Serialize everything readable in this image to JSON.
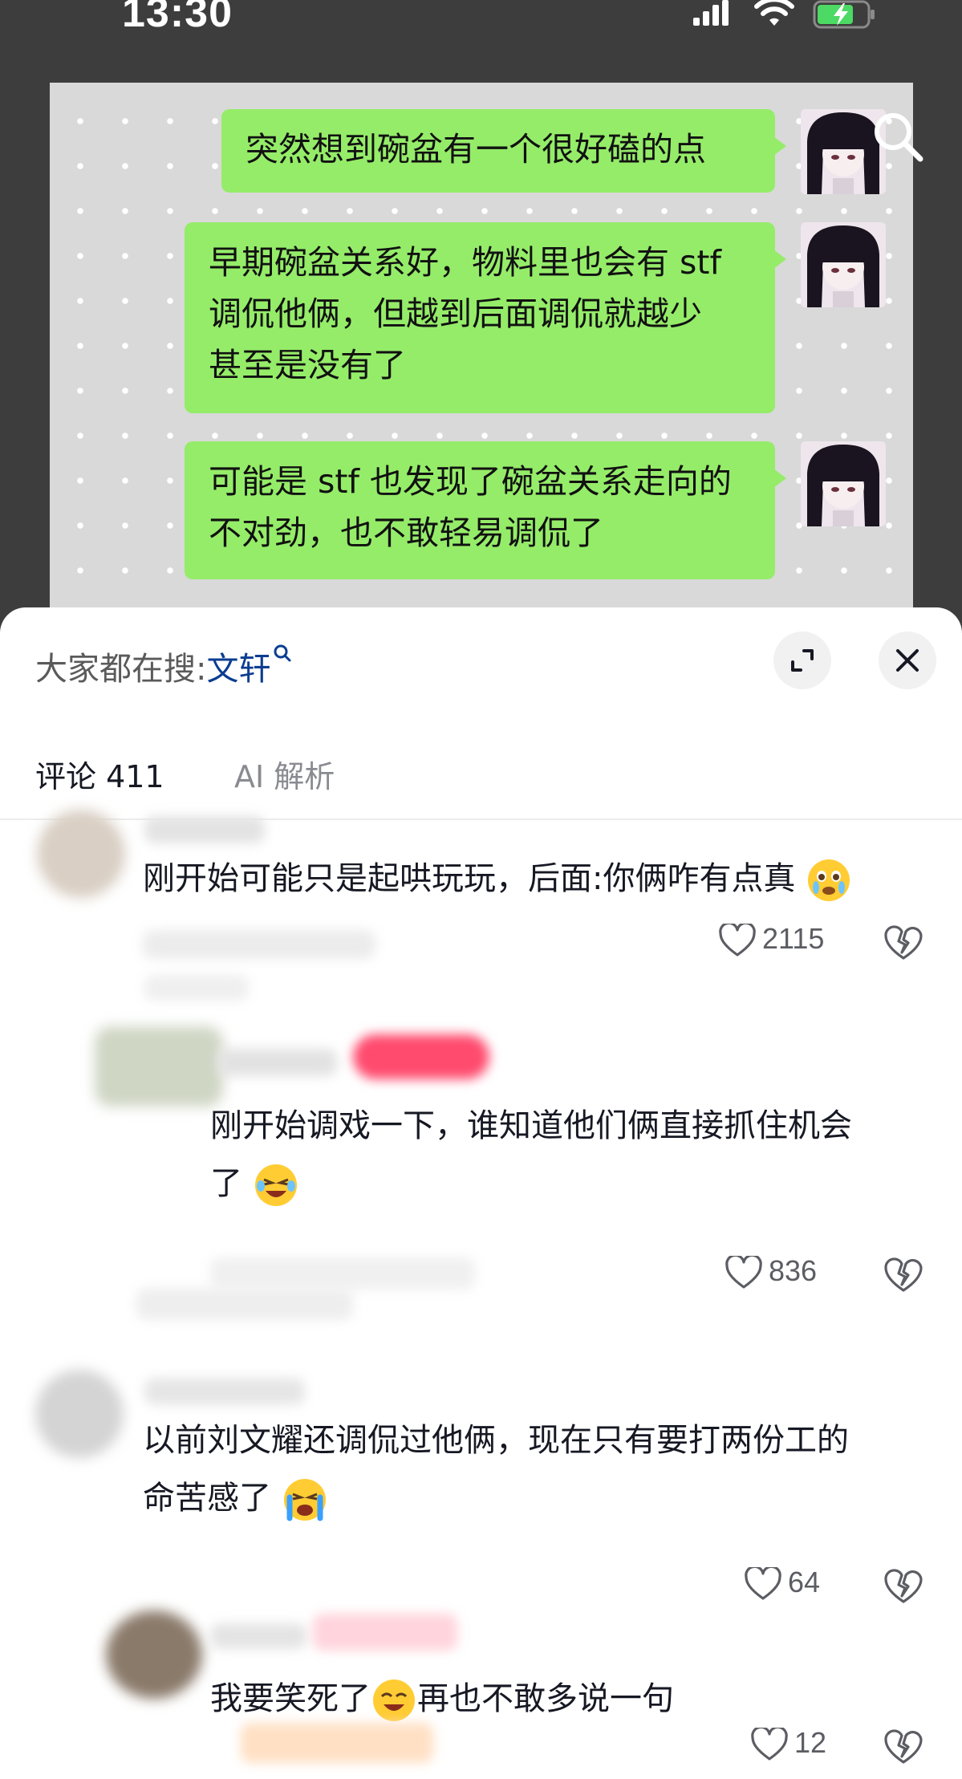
{
  "status": {
    "time": "13:30"
  },
  "chat_messages": [
    {
      "lines": [
        "突然想到碗盆有一个很好磕的点"
      ]
    },
    {
      "lines": [
        "早期碗盆关系好，物料里也会有 stf",
        "调侃他俩，但越到后面调侃就越少",
        "甚至是没有了"
      ]
    },
    {
      "lines": [
        "可能是 stf 也发现了碗盆关系走向的",
        "不对劲，也不敢轻易调侃了"
      ]
    }
  ],
  "panel": {
    "search_prefix": "大家都在搜:",
    "search_keyword": "文轩",
    "tab_comments": "评论 411",
    "tab_ai": "AI 解析"
  },
  "comments": [
    {
      "lines": [
        "刚开始可能只是起哄玩玩，后面:你俩咋有点真"
      ],
      "likes": "2115"
    },
    {
      "lines": [
        "刚开始调戏一下，谁知道他们俩直接抓住机会",
        "了"
      ],
      "likes": "836"
    },
    {
      "lines": [
        "以前刘文耀还调侃过他俩，现在只有要打两份工的",
        "命苦感了"
      ],
      "likes": "64"
    },
    {
      "lines": [
        "我要笑死了",
        "再也不敢多说一句"
      ],
      "likes": "12"
    }
  ],
  "colors": {
    "bubble": "#95ec69",
    "keyword": "#0b3d91",
    "overlay": "#3d3d3d"
  },
  "icons": [
    "search-icon",
    "expand-icon",
    "close-icon",
    "heart-icon",
    "broken-heart-icon",
    "wifi-icon",
    "battery-icon",
    "signal-icon"
  ]
}
